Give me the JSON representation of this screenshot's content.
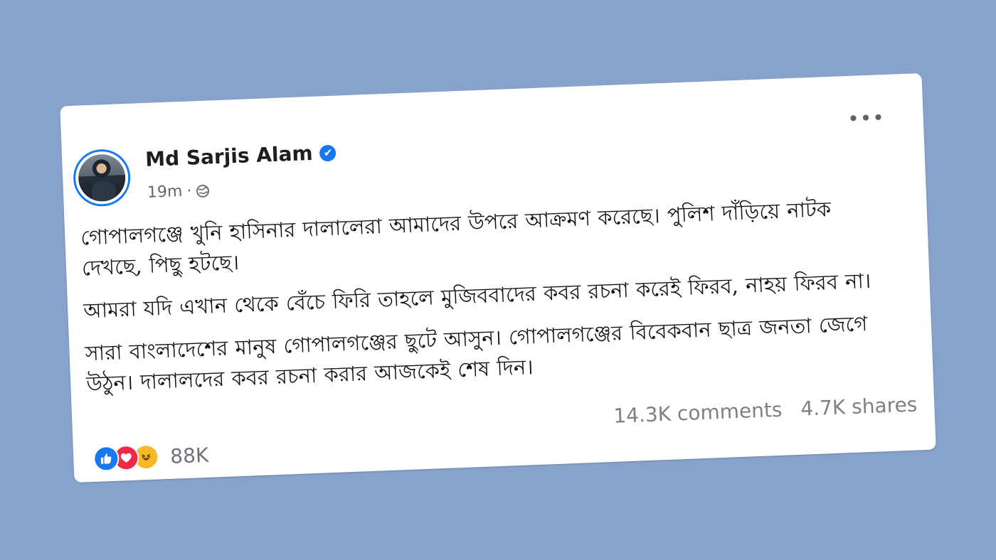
{
  "post": {
    "author": "Md Sarjis Alam",
    "time": "19m",
    "separator": "·",
    "paragraphs": [
      "গোপালগঞ্জে খুনি হাসিনার দালালেরা আমাদের উপরে আক্রমণ করেছে। পুলিশ দাঁড়িয়ে নাটক দেখছে, পিছু হটছে।",
      "আমরা যদি এখান থেকে বেঁচে ফিরি তাহলে মুজিববাদের কবর রচনা করেই ফিরব, নাহয় ফিরব না।",
      "সারা বাংলাদেশের মানুষ গোপালগঞ্জের ছুটে আসুন। গোপালগঞ্জের বিবেকবান ছাত্র জনতা জেগে উঠুন। দালালদের কবর রচনা করার আজকেই শেষ দিন।"
    ],
    "stats": {
      "comments": "14.3K comments",
      "shares": "4.7K shares"
    },
    "reactions": {
      "count": "88K",
      "icons": [
        "like-icon",
        "love-icon",
        "haha-icon"
      ]
    }
  },
  "icons": {
    "verified": "✔",
    "more": "•••"
  },
  "colors": {
    "background": "#87a2cb",
    "card": "#ffffff",
    "facebook_blue": "#1877f2",
    "love_red": "#f02849",
    "haha_yellow": "#f7b928"
  }
}
